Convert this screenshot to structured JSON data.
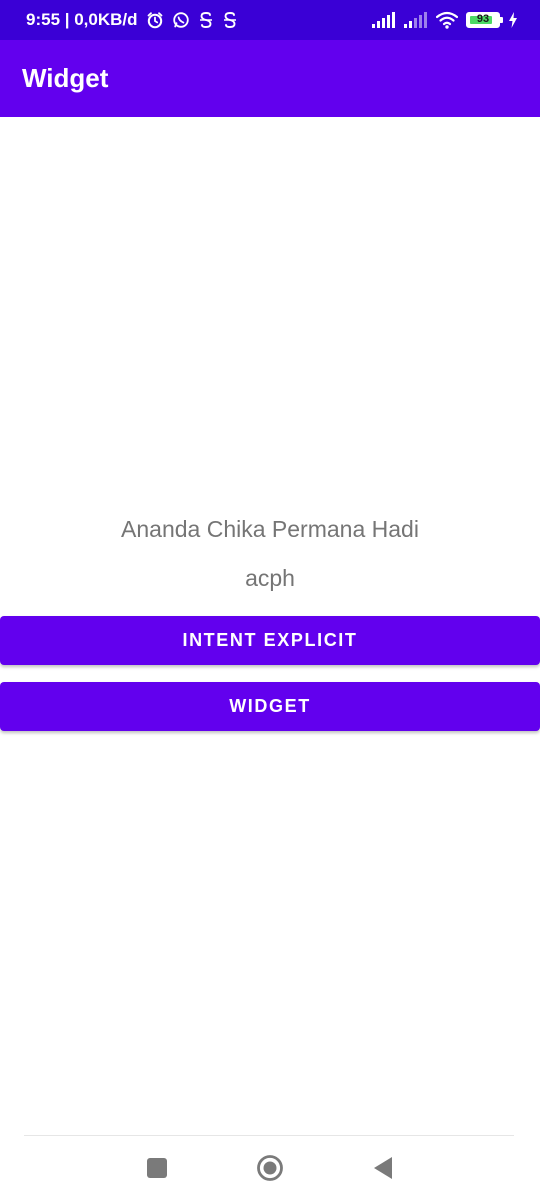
{
  "status_bar": {
    "time_and_speed": "9:55 | 0,0KB/d",
    "icons": [
      "alarm-icon",
      "whatsapp-icon",
      "s-app-icon",
      "s-app-icon",
      "signal-icon",
      "signal-weak-icon",
      "wifi-icon",
      "battery-icon",
      "charging-icon"
    ],
    "battery_level": "93"
  },
  "app_bar": {
    "title": "Widget"
  },
  "content": {
    "name": "Ananda Chika Permana Hadi",
    "nick": "acph"
  },
  "buttons": {
    "intent_label": "INTENT EXPLICIT",
    "widget_label": "WIDGET"
  },
  "nav_bar": {
    "icons": [
      "recents-icon",
      "home-icon",
      "back-icon"
    ]
  },
  "colors": {
    "status_bar": "#3A00D6",
    "primary": "#6200EE",
    "body_text": "#757575",
    "battery_fill": "#4CD964"
  }
}
